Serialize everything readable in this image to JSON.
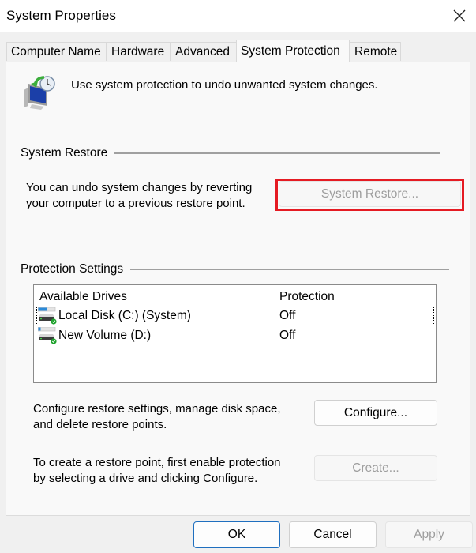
{
  "window": {
    "title": "System Properties",
    "close_icon": "close-icon"
  },
  "tabs": [
    {
      "label": "Computer Name",
      "active": false
    },
    {
      "label": "Hardware",
      "active": false
    },
    {
      "label": "Advanced",
      "active": false
    },
    {
      "label": "System Protection",
      "active": true
    },
    {
      "label": "Remote",
      "active": false
    }
  ],
  "intro": {
    "icon": "system-restore-icon",
    "text": "Use system protection to undo unwanted system changes."
  },
  "system_restore": {
    "group_label": "System Restore",
    "description_line1": "You can undo system changes by reverting",
    "description_line2": "your computer to a previous restore point.",
    "button_label": "System Restore...",
    "button_disabled": true,
    "highlight_color": "#e51b23"
  },
  "protection_settings": {
    "group_label": "Protection Settings",
    "columns": [
      "Available Drives",
      "Protection"
    ],
    "drives": [
      {
        "name": "Local Disk (C:) (System)",
        "protection": "Off",
        "focused": true,
        "icon": "drive-icon"
      },
      {
        "name": "New Volume (D:)",
        "protection": "Off",
        "focused": false,
        "icon": "drive-icon"
      }
    ],
    "configure_text_line1": "Configure restore settings, manage disk space,",
    "configure_text_line2": "and delete restore points.",
    "configure_button": "Configure...",
    "create_text_line1": "To create a restore point, first enable protection",
    "create_text_line2": "by selecting a drive and clicking Configure.",
    "create_button": "Create...",
    "create_disabled": true
  },
  "footer": {
    "ok": "OK",
    "cancel": "Cancel",
    "apply": "Apply",
    "apply_disabled": true
  }
}
